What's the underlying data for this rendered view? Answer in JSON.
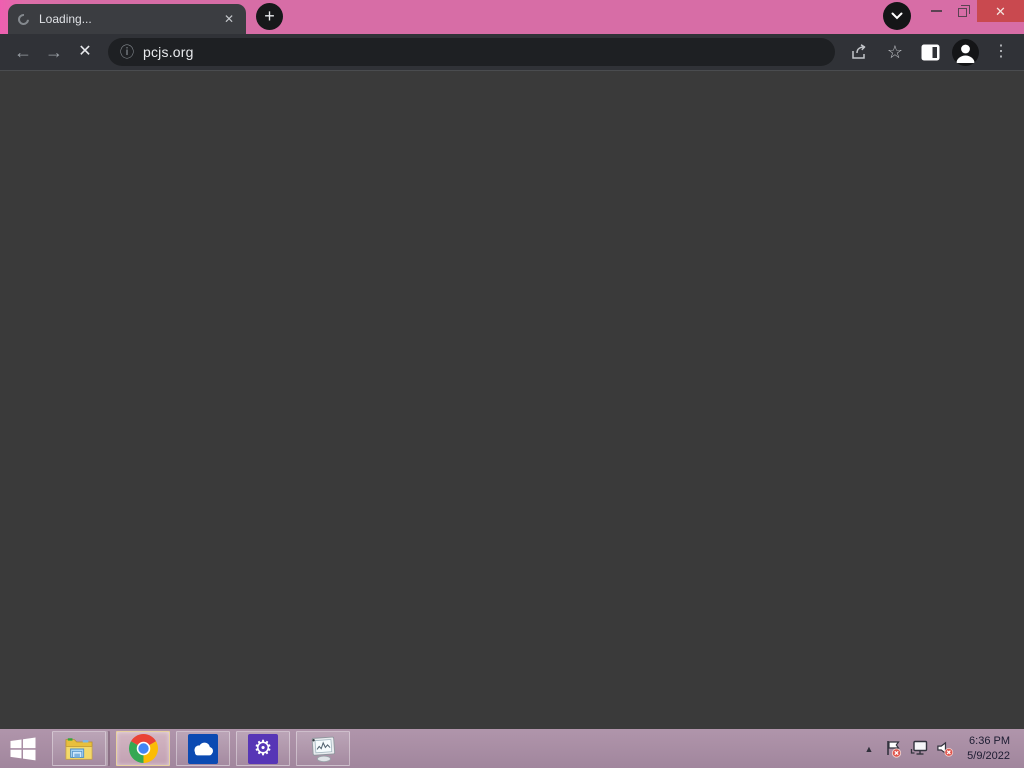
{
  "window": {
    "titlebar_pink": "#d76da6",
    "close_button_red": "#c9494f",
    "controls": {
      "minimize": "minimize",
      "restore": "restore",
      "close_glyph": "✕"
    }
  },
  "browser": {
    "tab": {
      "title": "Loading..."
    },
    "address_bar": {
      "url": "pcjs.org"
    },
    "icons": {
      "back": "←",
      "forward": "→",
      "stop": "✕",
      "page_info": "ⓘ",
      "bookmark_star": "☆",
      "menu_dots": "⋮",
      "new_tab_plus": "+",
      "tab_close": "✕"
    },
    "colors": {
      "toolbar": "#303237",
      "omnibox": "#1e2023",
      "page_background": "#3a3a3a"
    }
  },
  "taskbar": {
    "background": "#a88ba3",
    "apps": [
      "start",
      "file-explorer",
      "chrome",
      "onedrive",
      "settings",
      "system-monitor"
    ],
    "active_app": "chrome",
    "icons": {
      "settings_gear": "⚙",
      "show_hidden": "▲"
    },
    "icon_colors": {
      "onedrive_blue": "#0b4ab2",
      "settings_violet": "#5736b6",
      "chrome_red": "#ea4335",
      "chrome_yellow": "#fbbc05",
      "chrome_green": "#34a853",
      "chrome_blue": "#4285f4"
    },
    "clock": {
      "time": "6:36 PM",
      "date": "5/9/2022"
    }
  }
}
